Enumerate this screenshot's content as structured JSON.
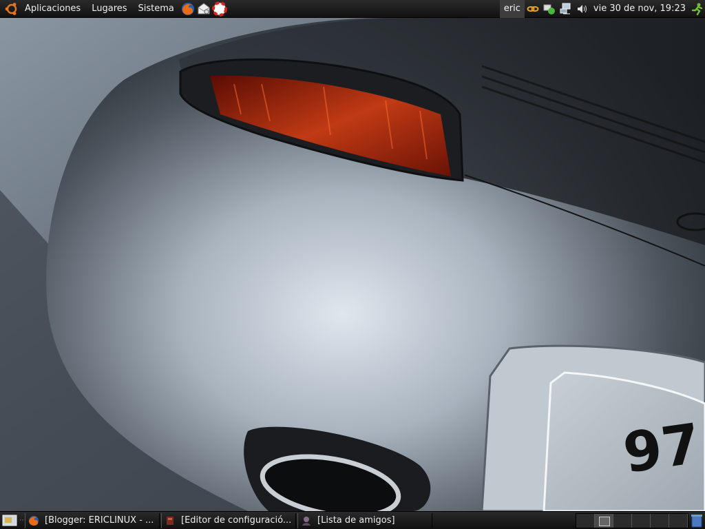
{
  "top_panel": {
    "menus": [
      "Aplicaciones",
      "Lugares",
      "Sistema"
    ],
    "launchers": [
      "firefox-icon",
      "mail-icon",
      "help-icon"
    ],
    "user": "eric",
    "tray": [
      "chain-icon",
      "network-status-icon",
      "network-icon",
      "volume-icon"
    ],
    "clock": "vie 30 de nov, 19:23",
    "quit_icon": "running-man-icon"
  },
  "wallpaper": {
    "plate_text": "97"
  },
  "bottom_panel": {
    "tasks": [
      {
        "icon": "firefox-icon",
        "label": "[Blogger: ERICLINUX - ..."
      },
      {
        "icon": "config-editor-icon",
        "label": "[Editor de configuració..."
      },
      {
        "icon": "buddy-list-icon",
        "label": "[Lista de amigos]"
      }
    ],
    "workspaces": 6,
    "active_workspace": 1
  },
  "colors": {
    "panel": "#1a1a1a",
    "car_body": "#8c96a2",
    "taillight": "#b0240c"
  }
}
